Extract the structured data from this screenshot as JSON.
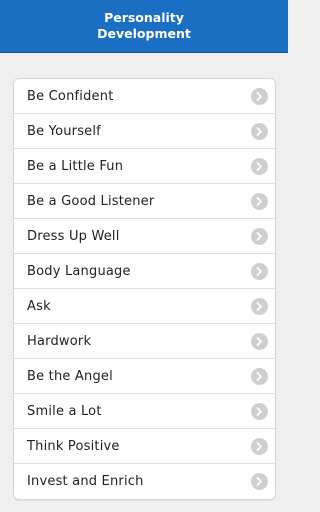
{
  "header": {
    "title_line1": "Personality",
    "title_line2": "Development"
  },
  "list": {
    "items": [
      {
        "label": "Be Confident",
        "icon": "chevron-right-icon"
      },
      {
        "label": "Be Yourself",
        "icon": "chevron-right-icon"
      },
      {
        "label": "Be a Little Fun",
        "icon": "chevron-right-icon"
      },
      {
        "label": "Be a Good Listener",
        "icon": "chevron-right-icon"
      },
      {
        "label": "Dress Up Well",
        "icon": "chevron-right-icon"
      },
      {
        "label": "Body Language",
        "icon": "chevron-right-icon"
      },
      {
        "label": "Ask",
        "icon": "chevron-right-icon"
      },
      {
        "label": "Hardwork",
        "icon": "chevron-right-icon"
      },
      {
        "label": "Be the Angel",
        "icon": "chevron-right-icon"
      },
      {
        "label": "Smile a Lot",
        "icon": "chevron-right-icon"
      },
      {
        "label": "Think Positive",
        "icon": "chevron-right-icon"
      },
      {
        "label": "Invest and Enrich",
        "icon": "chevron-right-icon"
      }
    ]
  },
  "colors": {
    "header_bg": "#1a6fc4",
    "page_bg": "#efefef",
    "chevron_bg": "#cfcfcf"
  }
}
